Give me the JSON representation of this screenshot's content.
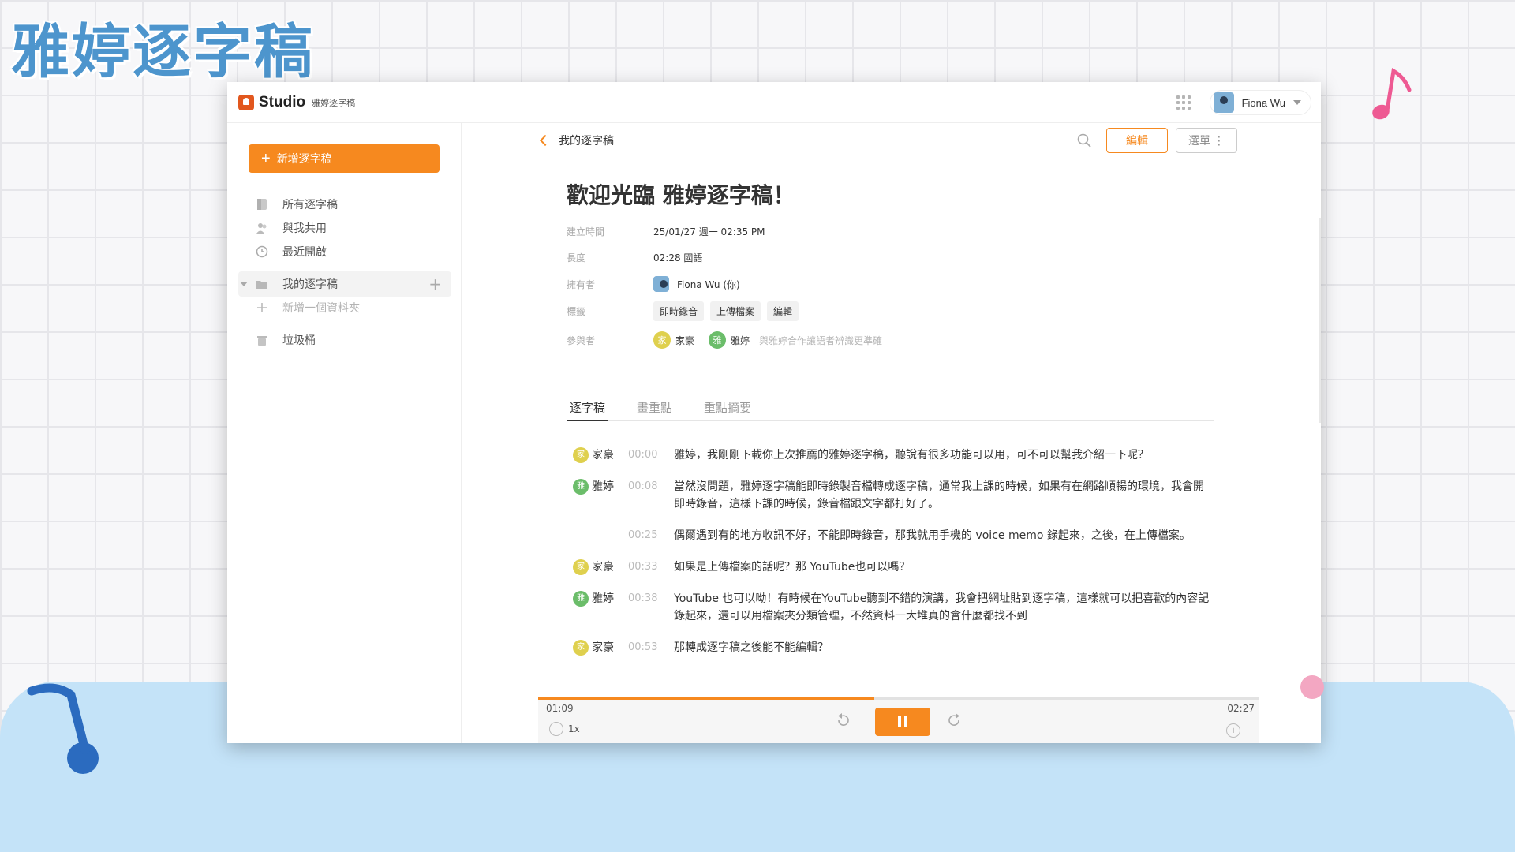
{
  "slide": {
    "title": "雅婷逐字稿"
  },
  "app": {
    "brand": "Studio",
    "brand_sub": "雅婷逐字稿",
    "user_name": "Fiona Wu"
  },
  "sidebar": {
    "new_button": "新增逐字稿",
    "items": [
      {
        "label": "所有逐字稿",
        "icon": "document-icon"
      },
      {
        "label": "與我共用",
        "icon": "people-icon"
      },
      {
        "label": "最近開啟",
        "icon": "clock-icon"
      },
      {
        "label": "我的逐字稿",
        "icon": "folder-icon"
      },
      {
        "label": "新增一個資料夾",
        "icon": "plus-icon"
      },
      {
        "label": "垃圾桶",
        "icon": "trash-icon"
      }
    ]
  },
  "header": {
    "back_label": "我的逐字稿",
    "edit_button": "編輯",
    "menu_button": "選單 ⋮"
  },
  "document": {
    "title": "歡迎光臨 雅婷逐字稿！",
    "meta": {
      "created_label": "建立時間",
      "created_value": "25/01/27 週一 02:35 PM",
      "length_label": "長度",
      "length_value": "02:28 國語",
      "owner_label": "擁有者",
      "owner_value": "Fiona Wu (你)",
      "tags_label": "標籤",
      "tags": [
        "即時錄音",
        "上傳檔案",
        "編輯"
      ],
      "participants_label": "參與者",
      "participants": [
        {
          "initial": "家",
          "name": "家豪",
          "color": "#dfd04e"
        },
        {
          "initial": "雅",
          "name": "雅婷",
          "color": "#6bbd6a"
        }
      ],
      "participants_note": "與雅婷合作讓語者辨識更準確"
    }
  },
  "tabs": [
    "逐字稿",
    "畫重點",
    "重點摘要"
  ],
  "transcript": [
    {
      "initial": "家",
      "speaker": "家豪",
      "color": "y",
      "time": "00:00",
      "text": "雅婷，我剛剛下載你上次推薦的雅婷逐字稿，聽說有很多功能可以用，可不可以幫我介紹一下呢？"
    },
    {
      "initial": "雅",
      "speaker": "雅婷",
      "color": "g",
      "time": "00:08",
      "text": "當然沒問題，雅婷逐字稿能即時錄製音檔轉成逐字稿，通常我上課的時候，如果有在網路順暢的環境，我會開即時錄音，這樣下課的時候，錄音檔跟文字都打好了。"
    },
    {
      "initial": "",
      "speaker": "",
      "color": "",
      "time": "00:25",
      "text": "偶爾遇到有的地方收訊不好，不能即時錄音，那我就用手機的 voice memo 錄起來，之後，在上傳檔案。"
    },
    {
      "initial": "家",
      "speaker": "家豪",
      "color": "y",
      "time": "00:33",
      "text": "如果是上傳檔案的話呢？那 YouTube也可以嗎？"
    },
    {
      "initial": "雅",
      "speaker": "雅婷",
      "color": "g",
      "time": "00:38",
      "text": "YouTube 也可以呦！有時候在YouTube聽到不錯的演講，我會把網址貼到逐字稿，這樣就可以把喜歡的內容記錄起來，還可以用檔案夾分類管理，不然資料一大堆真的會什麼都找不到"
    },
    {
      "initial": "家",
      "speaker": "家豪",
      "color": "y",
      "time": "00:53",
      "text": "那轉成逐字稿之後能不能編輯？"
    }
  ],
  "player": {
    "current": "01:09",
    "total": "02:27",
    "speed": "1x",
    "progress": 0.466
  },
  "colors": {
    "accent": "#f6891f",
    "title_blue": "#4d95cd"
  }
}
